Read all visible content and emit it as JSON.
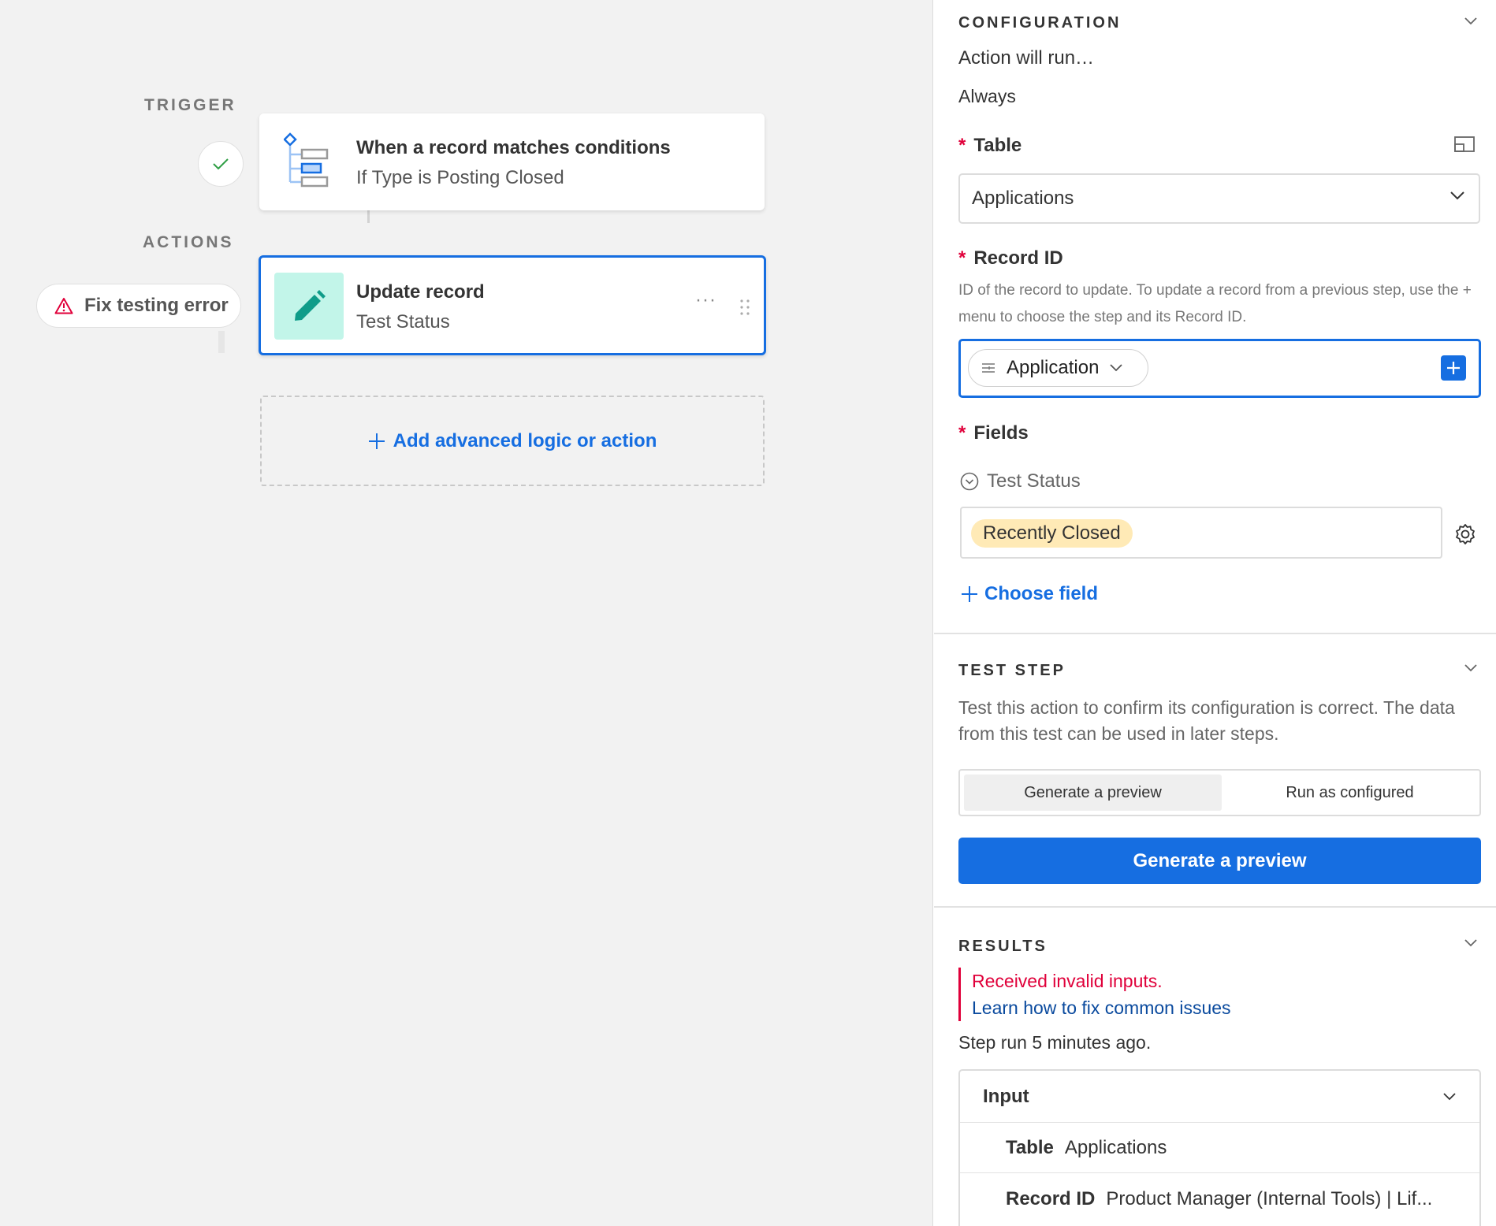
{
  "canvas": {
    "trigger_label": "TRIGGER",
    "actions_label": "ACTIONS",
    "trigger_card": {
      "title": "When a record matches conditions",
      "subtitle": "If Type is Posting Closed"
    },
    "action_card": {
      "title": "Update record",
      "subtitle": "Test Status",
      "more": "···"
    },
    "fix_error_label": "Fix testing error",
    "add_logic_label": "Add advanced logic or action"
  },
  "configuration": {
    "heading": "CONFIGURATION",
    "run_condition_label": "Action will run…",
    "run_condition_value": "Always",
    "table": {
      "label": "Table",
      "value": "Applications"
    },
    "record_id": {
      "label": "Record ID",
      "help": "ID of the record to update. To update a record from a previous step, use the + menu to choose the step and its Record ID.",
      "token": "Application"
    },
    "fields": {
      "label": "Fields",
      "items": [
        {
          "name": "Test Status",
          "value": "Recently Closed"
        }
      ],
      "choose_field": "Choose field"
    }
  },
  "test_step": {
    "heading": "TEST STEP",
    "description": "Test this action to confirm its configuration is correct. The data from this test can be used in later steps.",
    "modes": [
      "Generate a preview",
      "Run as configured"
    ],
    "selected_mode": "Generate a preview",
    "button": "Generate a preview"
  },
  "results": {
    "heading": "RESULTS",
    "error": "Received invalid inputs.",
    "link": "Learn how to fix common issues",
    "step_run": "Step run 5 minutes ago.",
    "input": {
      "heading": "Input",
      "rows": [
        {
          "key": "Table",
          "value": "Applications"
        },
        {
          "key": "Record ID",
          "value": "Product Manager (Internal Tools) | Lif..."
        }
      ]
    }
  },
  "colors": {
    "accent": "#166ee1",
    "error": "#e0003a",
    "select_pill": "#ffeab6",
    "action_tile": "#c2f5e9"
  }
}
